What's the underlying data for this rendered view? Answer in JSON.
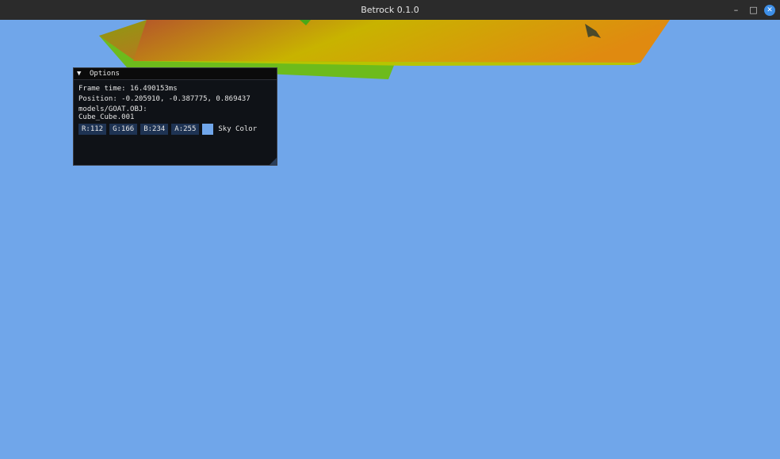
{
  "window": {
    "title": "Betrock 0.1.0",
    "min_glyph": "–",
    "max_glyph": "□",
    "close_glyph": "✕",
    "close_color": "#3d8ee6"
  },
  "scene": {
    "sky_color": "#70a6ea",
    "model_colors": [
      "#c8b300",
      "#e06c1a",
      "#6dbb1c"
    ]
  },
  "options": {
    "title": "Options",
    "collapse_glyph": "▼",
    "frame_time": "Frame time: 16.490153ms",
    "position": "Position: -0.205910, -0.387775, 0.869437",
    "model_path": "models/GOAT.OBJ:",
    "model_name": "Cube_Cube.001",
    "sky_color": {
      "r": "R:112",
      "g": "G:166",
      "b": "B:234",
      "a": "A:255",
      "label": "Sky Color",
      "hex": "#70a6ea"
    }
  }
}
